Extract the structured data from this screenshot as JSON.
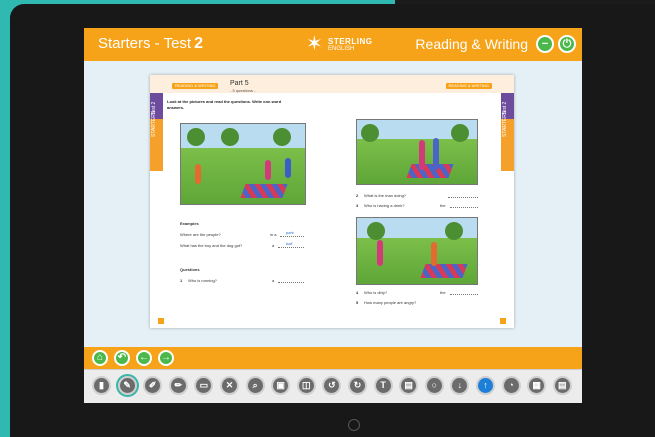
{
  "header": {
    "test_label": "Starters - Test",
    "test_number": "2",
    "logo_line1": "STERLING",
    "logo_line2": "ENGLISH",
    "section_title": "Reading & Writing",
    "buttons": [
      {
        "name": "minus-icon",
        "glyph": "−"
      },
      {
        "name": "power-icon",
        "glyph": "⏻"
      }
    ]
  },
  "page": {
    "tag_left": "READING & WRITING",
    "tag_right": "READING & WRITING",
    "part_title": "Part 5",
    "part_subtitle": "- 5 questions -",
    "side_tab_left_top": "Test 2",
    "side_tab_left": "STARTERS",
    "side_tab_right_top": "Test 2",
    "side_tab_right": "STARTERS",
    "instructions": "Look at the pictures and read the questions. Write one-word answers.",
    "examples_heading": "Examples",
    "example_q1": "Where are the people?",
    "example_q1_prefix": "in a",
    "example_q1_answer": "park",
    "example_q2": "What has the boy and the dog got?",
    "example_q2_prefix": "a",
    "example_q2_answer": "ball",
    "questions_heading": "Questions",
    "q1": "Who is running?",
    "q1_prefix": "a",
    "q2": "What is the man doing?",
    "q3": "Who is having a drink?",
    "q3_prefix": "the",
    "q4": "Who is dirty?",
    "q4_prefix": "the",
    "q5": "How many people are angry?",
    "numbers": [
      "1",
      "2",
      "3",
      "4",
      "5"
    ]
  },
  "nav": [
    {
      "name": "home-icon",
      "glyph": "⌂"
    },
    {
      "name": "undo-arrow-icon",
      "glyph": "↶"
    },
    {
      "name": "arrow-left-icon",
      "glyph": "←"
    },
    {
      "name": "arrow-right-icon",
      "glyph": "→"
    }
  ],
  "tools": [
    {
      "name": "book-icon",
      "glyph": "▮"
    },
    {
      "name": "pen-icon",
      "glyph": "✎"
    },
    {
      "name": "pencil-icon",
      "glyph": "✐"
    },
    {
      "name": "marker-icon",
      "glyph": "✏"
    },
    {
      "name": "eraser-icon",
      "glyph": "▭"
    },
    {
      "name": "close-icon",
      "glyph": "✕"
    },
    {
      "name": "zoom-icon",
      "glyph": "⌕"
    },
    {
      "name": "single-page-icon",
      "glyph": "▣"
    },
    {
      "name": "double-page-icon",
      "glyph": "◫"
    },
    {
      "name": "undo-icon",
      "glyph": "↺"
    },
    {
      "name": "redo-icon",
      "glyph": "↻"
    },
    {
      "name": "text-tool-icon",
      "glyph": "T"
    },
    {
      "name": "notes-icon",
      "glyph": "▤"
    },
    {
      "name": "idea-icon",
      "glyph": "○"
    },
    {
      "name": "download-icon",
      "glyph": "↓"
    },
    {
      "name": "upload-icon",
      "glyph": "↑"
    },
    {
      "name": "timer-icon",
      "glyph": "◔"
    },
    {
      "name": "keyboard-icon",
      "glyph": "▦"
    },
    {
      "name": "print-icon",
      "glyph": "▤"
    }
  ],
  "colors": {
    "brand_orange": "#f7a31a",
    "button_green": "#4ab84a",
    "frame_teal": "#2fb9b0",
    "tab_purple": "#6d4c9e",
    "active_blue": "#1e7fd8"
  }
}
